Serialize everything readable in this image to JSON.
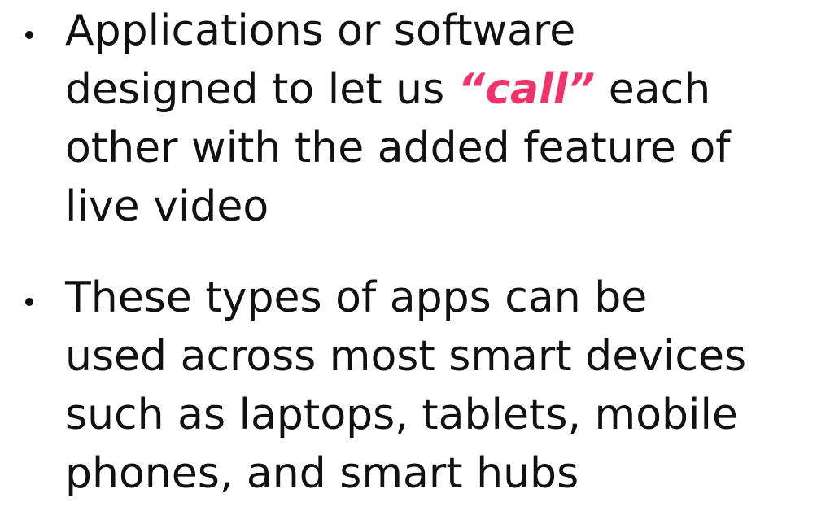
{
  "bullets": [
    {
      "lines": [
        "Applications or software",
        "designed to let us ",
        "other with the added feature of",
        "live video"
      ],
      "emphasis": "“call”",
      "after_emphasis": " each"
    },
    {
      "lines": [
        "These types of apps can be",
        "used across most smart devices",
        "such as laptops, tablets, mobile",
        "phones, and smart hubs"
      ]
    }
  ],
  "colors": {
    "text": "#111111",
    "accent": "#f0336b",
    "background": "#ffffff"
  }
}
